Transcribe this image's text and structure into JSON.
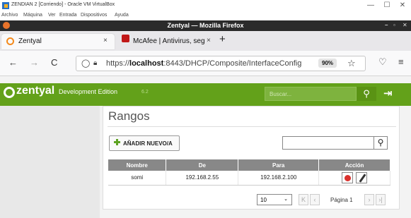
{
  "vbox": {
    "title": "ZENDIAN 2 [Corriendo] - Oracle VM VirtualBox",
    "menu": [
      "Archivo",
      "Máquina",
      "Ver",
      "Entrada",
      "Dispositivos",
      "Ayuda"
    ],
    "controls": {
      "minimize": "—",
      "maximize": "☐",
      "close": "✕"
    }
  },
  "firefox": {
    "window_title": "Zentyal — Mozilla Firefox",
    "tabs": [
      {
        "label": "Zentyal",
        "close": "×",
        "active": true
      },
      {
        "label": "McAfee | Antivirus, segur",
        "close": "×",
        "active": false
      }
    ],
    "new_tab": "+",
    "nav": {
      "back": "←",
      "forward": "→",
      "reload": "C"
    },
    "url_prefix": "https://",
    "url_host": "localhost",
    "url_rest": ":8443/DHCP/Composite/InterfaceConfig",
    "zoom": "90%",
    "bookmark_star": "☆",
    "pocket": "♡",
    "menu": "≡"
  },
  "zentyal": {
    "logo": "zentyal",
    "edition": "Development Edition",
    "version": "6.2",
    "search_placeholder": "Buscar...",
    "page_title": "Rangos",
    "add_button": "AÑADIR NUEVO/A",
    "table": {
      "headers": [
        "Nombre",
        "De",
        "Para",
        "Acción"
      ],
      "rows": [
        {
          "name": "somi",
          "from": "192.168.2.55",
          "to": "192.168.2.100"
        }
      ]
    },
    "page_size": "10",
    "page_label": "Página 1",
    "colors": {
      "header_green": "#63a11a",
      "table_header": "#888888"
    }
  }
}
